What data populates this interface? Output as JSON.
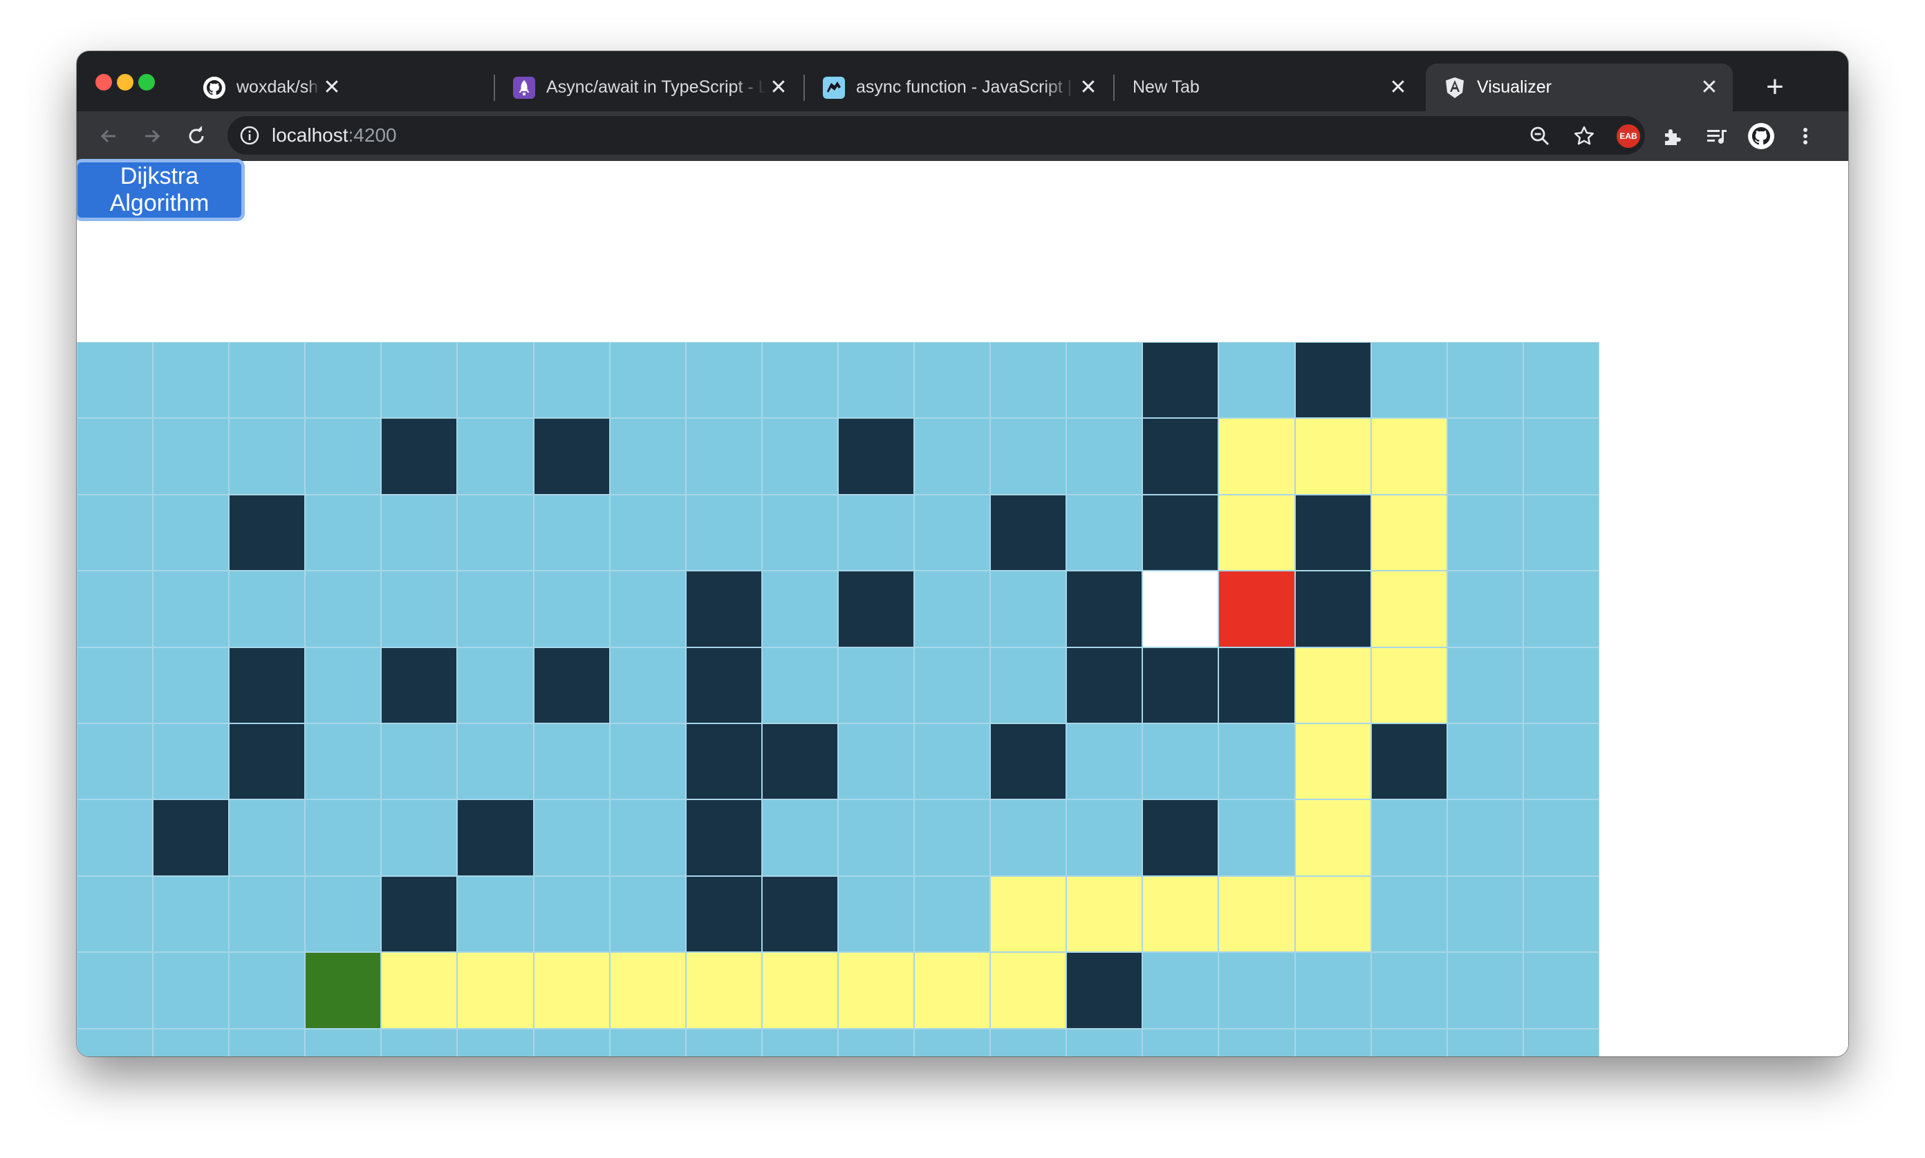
{
  "browser": {
    "tabs": [
      {
        "title": "woxdak/shadowDijkstra_Solver",
        "favicon": "github-icon",
        "active": false
      },
      {
        "title": "Async/await in TypeScript - LogRocket Blog",
        "favicon": "rocket-icon",
        "active": false
      },
      {
        "title": "async function - JavaScript | MDN",
        "favicon": "mdn-icon",
        "active": false
      },
      {
        "title": "New Tab",
        "favicon": "",
        "active": false
      },
      {
        "title": "Visualizer",
        "favicon": "angular-icon",
        "active": true
      }
    ],
    "new_tab_label": "+",
    "close_glyph": "✕",
    "address": {
      "host": "localhost",
      "port": ":4200"
    },
    "extension_badge": "EAB"
  },
  "app": {
    "algorithm_button": "Dijkstra Algorithm"
  },
  "grid": {
    "rows": 10,
    "cols": 20,
    "legend": {
      "E": "empty",
      "W": "wall",
      "P": "path",
      "S": "start",
      "T": "target",
      "V": "unvisited-node"
    },
    "colors": {
      "E": "#7fcae0",
      "W": "#183346",
      "P": "#fefa82",
      "S": "#377c21",
      "T": "#e83024",
      "V": "#ffffff"
    },
    "cells": [
      "EEEEEEEEEEEEEEWEWEEE",
      "EEEEWEWEEEWEEEWPPPEE",
      "EEWEEEEEEEEEWEWPWPEE",
      "EEEEEEEEWEWEEWVTWPEE",
      "EEWEWEWEWEEEEWWWPPEE",
      "EEWEEEEEWWEEWEEEPWEE",
      "EWEEEWEEWEEEEEWEPEEE",
      "EEEEWEEEWWEEPPPPPEEE",
      "EEESPPPPPPPPPWEEEEEE",
      "EEEEEEEEEEEEEEEEEEEE"
    ]
  }
}
